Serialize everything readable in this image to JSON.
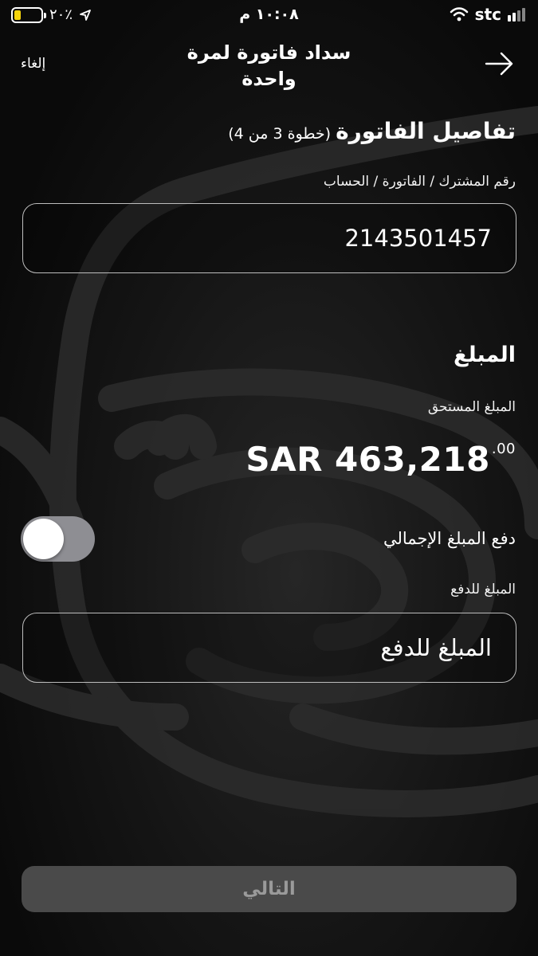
{
  "status_bar": {
    "time": "١٠:٠٨ م",
    "battery_percent": "٢٠٪",
    "carrier": "stc"
  },
  "nav": {
    "title": "سداد فاتورة لمرة واحدة",
    "cancel_label": "إلغاء",
    "back_icon": "arrow-right-icon"
  },
  "bill_details": {
    "title": "تفاصيل الفاتورة",
    "step": "(خطوة 3 من 4)",
    "account_label": "رقم المشترك / الفاتورة / الحساب",
    "account_value": "2143501457"
  },
  "amount": {
    "heading": "المبلغ",
    "due_label": "المبلغ المستحق",
    "due_main": "SAR 463,218",
    "due_decimals": ".00",
    "pay_full_label": "دفع المبلغ الإجمالي",
    "pay_full_on": false,
    "pay_label": "المبلغ للدفع",
    "pay_placeholder": "المبلغ للدفع"
  },
  "actions": {
    "next_label": "التالي"
  },
  "colors": {
    "background": "#0a0a0a",
    "battery_level": "#f5d40c",
    "toggle_off": "#8e8e93",
    "button_disabled": "#4a4a4a"
  }
}
